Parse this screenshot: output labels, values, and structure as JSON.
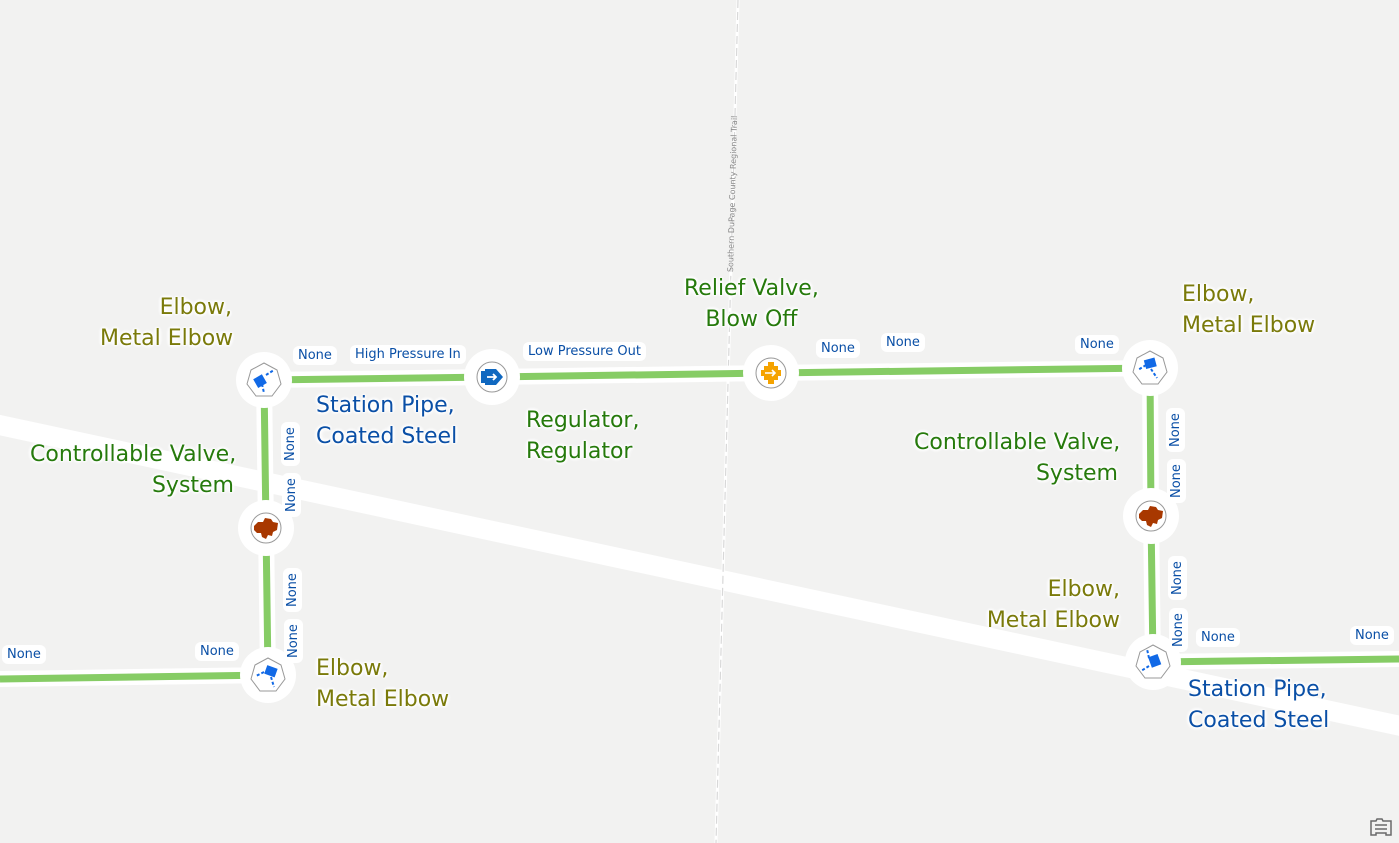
{
  "map": {
    "trail_label": "Southern DuPage County Regional Trail",
    "colors": {
      "background": "#f2f2f1",
      "road": "#ffffff",
      "pipe": "#86cc65",
      "label_green": "#267a0c",
      "label_olive": "#7a7a0a",
      "label_blue": "#0a4fa6",
      "elbow_icon": "#1169e6",
      "regulator_icon": "#1068c0",
      "relief_valve_icon": "#f5a300",
      "controllable_valve_icon": "#a83800"
    }
  },
  "features": {
    "elbow_top_left": {
      "line1": "Elbow,",
      "line2": "Metal Elbow"
    },
    "elbow_bottom_left": {
      "line1": "Elbow,",
      "line2": "Metal Elbow"
    },
    "elbow_top_right": {
      "line1": "Elbow,",
      "line2": "Metal Elbow"
    },
    "elbow_bottom_right": {
      "line1": "Elbow,",
      "line2": "Metal Elbow"
    },
    "valve_left": {
      "line1": "Controllable Valve,",
      "line2": "System"
    },
    "valve_right": {
      "line1": "Controllable Valve,",
      "line2": "System"
    },
    "regulator": {
      "line1": "Regulator,",
      "line2": "Regulator"
    },
    "relief_valve": {
      "line1": "Relief Valve,",
      "line2": "Blow Off"
    },
    "pipe_left": {
      "line1": "Station Pipe,",
      "line2": "Coated Steel"
    },
    "pipe_right": {
      "line1": "Station Pipe,",
      "line2": "Coated Steel"
    }
  },
  "terminal_labels": {
    "high_pressure_in": "High Pressure In",
    "low_pressure_out": "Low Pressure Out",
    "none": "None"
  },
  "icons": {
    "attribution": "basemap-attribution-icon"
  }
}
